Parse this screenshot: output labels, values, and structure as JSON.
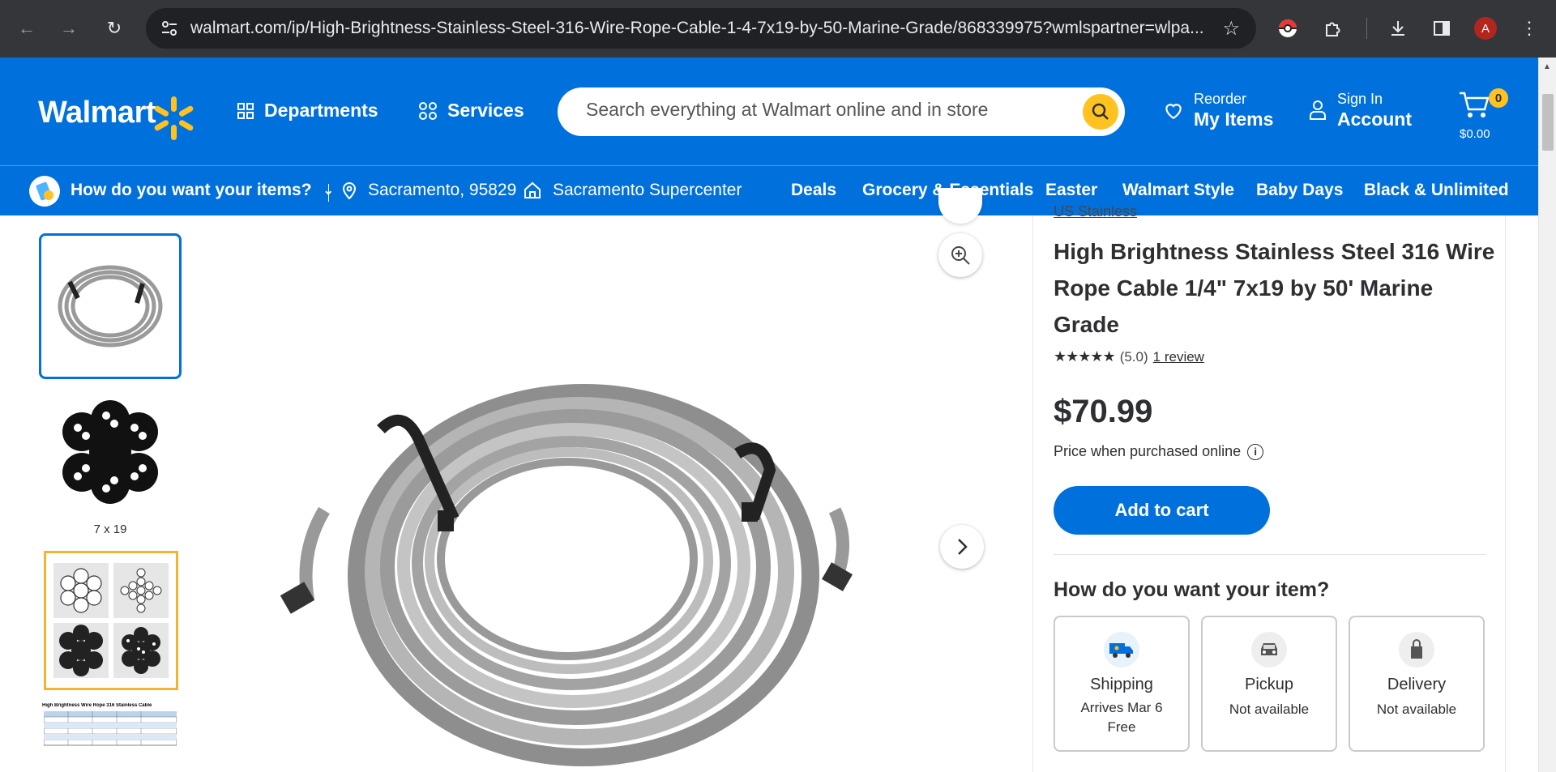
{
  "browser": {
    "url": "walmart.com/ip/High-Brightness-Stainless-Steel-316-Wire-Rope-Cable-1-4-7x19-by-50-Marine-Grade/868339975?wmlspartner=wlpa...",
    "profile_initial": "A"
  },
  "header": {
    "logo": "Walmart",
    "departments": "Departments",
    "services": "Services",
    "search_placeholder": "Search everything at Walmart online and in store",
    "reorder_small": "Reorder",
    "reorder_big": "My Items",
    "signin_small": "Sign In",
    "signin_big": "Account",
    "cart_count": "0",
    "cart_total": "$0.00"
  },
  "subnav": {
    "how": "How do you want your items?",
    "location": "Sacramento, 95829",
    "store": "Sacramento Supercenter",
    "links": [
      "Deals",
      "Grocery & Essentials",
      "Easter",
      "Walmart Style",
      "Baby Days",
      "Black & Unlimited"
    ]
  },
  "gallery": {
    "caption_2": "7 x 19",
    "table_title": "High Brightness Wire Rope 316 Stainless Cable"
  },
  "product": {
    "brand": "US Stainless",
    "title": "High Brightness Stainless Steel 316 Wire Rope Cable 1/4\" 7x19 by 50' Marine Grade",
    "rating": "(5.0)",
    "reviews": "1 review",
    "price": "$70.99",
    "price_note": "Price when purchased online",
    "add_to_cart": "Add to cart"
  },
  "fulfillment": {
    "heading": "How do you want your item?",
    "options": [
      {
        "name": "Shipping",
        "line1": "Arrives Mar 6",
        "line2": "Free"
      },
      {
        "name": "Pickup",
        "line1": "Not available",
        "line2": ""
      },
      {
        "name": "Delivery",
        "line1": "Not available",
        "line2": ""
      }
    ]
  },
  "colors": {
    "brand_blue": "#0071dc",
    "spark_yellow": "#ffc220"
  }
}
